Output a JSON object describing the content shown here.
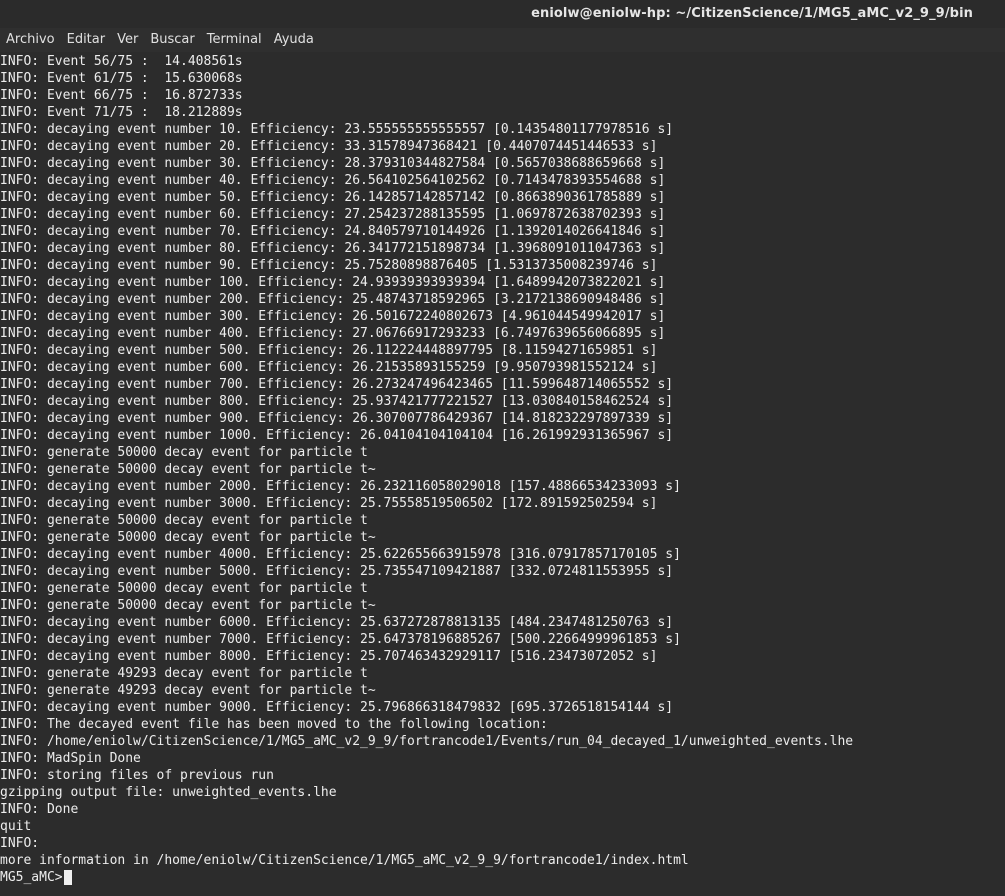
{
  "window": {
    "title": "eniolw@eniolw-hp: ~/CitizenScience/1/MG5_aMC_v2_9_9/bin"
  },
  "menu": {
    "items": [
      "Archivo",
      "Editar",
      "Ver",
      "Buscar",
      "Terminal",
      "Ayuda"
    ]
  },
  "terminal": {
    "lines": [
      "INFO: Event 56/75 :  14.408561s",
      "INFO: Event 61/75 :  15.630068s",
      "INFO: Event 66/75 :  16.872733s",
      "INFO: Event 71/75 :  18.212889s",
      "INFO: decaying event number 10. Efficiency: 23.555555555555557 [0.14354801177978516 s]",
      "INFO: decaying event number 20. Efficiency: 33.31578947368421 [0.4407074451446533 s]",
      "INFO: decaying event number 30. Efficiency: 28.379310344827584 [0.5657038688659668 s]",
      "INFO: decaying event number 40. Efficiency: 26.564102564102562 [0.7143478393554688 s]",
      "INFO: decaying event number 50. Efficiency: 26.142857142857142 [0.8663890361785889 s]",
      "INFO: decaying event number 60. Efficiency: 27.254237288135595 [1.0697872638702393 s]",
      "INFO: decaying event number 70. Efficiency: 24.840579710144926 [1.1392014026641846 s]",
      "INFO: decaying event number 80. Efficiency: 26.341772151898734 [1.3968091011047363 s]",
      "INFO: decaying event number 90. Efficiency: 25.75280898876405 [1.5313735008239746 s]",
      "INFO: decaying event number 100. Efficiency: 24.93939393939394 [1.6489942073822021 s]",
      "INFO: decaying event number 200. Efficiency: 25.48743718592965 [3.2172138690948486 s]",
      "INFO: decaying event number 300. Efficiency: 26.501672240802673 [4.961044549942017 s]",
      "INFO: decaying event number 400. Efficiency: 27.06766917293233 [6.7497639656066895 s]",
      "INFO: decaying event number 500. Efficiency: 26.112224448897795 [8.11594271659851 s]",
      "INFO: decaying event number 600. Efficiency: 26.21535893155259 [9.950793981552124 s]",
      "INFO: decaying event number 700. Efficiency: 26.273247496423465 [11.599648714065552 s]",
      "INFO: decaying event number 800. Efficiency: 25.937421777221527 [13.030840158462524 s]",
      "INFO: decaying event number 900. Efficiency: 26.307007786429367 [14.818232297897339 s]",
      "INFO: decaying event number 1000. Efficiency: 26.04104104104104 [16.261992931365967 s]",
      "INFO: generate 50000 decay event for particle t",
      "INFO: generate 50000 decay event for particle t~",
      "INFO: decaying event number 2000. Efficiency: 26.232116058029018 [157.48866534233093 s]",
      "INFO: decaying event number 3000. Efficiency: 25.75558519506502 [172.891592502594 s]",
      "INFO: generate 50000 decay event for particle t",
      "INFO: generate 50000 decay event for particle t~",
      "INFO: decaying event number 4000. Efficiency: 25.622655663915978 [316.07917857170105 s]",
      "INFO: decaying event number 5000. Efficiency: 25.735547109421887 [332.0724811553955 s]",
      "INFO: generate 50000 decay event for particle t",
      "INFO: generate 50000 decay event for particle t~",
      "INFO: decaying event number 6000. Efficiency: 25.637272878813135 [484.2347481250763 s]",
      "INFO: decaying event number 7000. Efficiency: 25.647378196885267 [500.22664999961853 s]",
      "INFO: decaying event number 8000. Efficiency: 25.707463432929117 [516.23473072052 s]",
      "INFO: generate 49293 decay event for particle t",
      "INFO: generate 49293 decay event for particle t~",
      "INFO: decaying event number 9000. Efficiency: 25.796866318479832 [695.3726518154144 s]",
      "INFO: The decayed event file has been moved to the following location:",
      "INFO: /home/eniolw/CitizenScience/1/MG5_aMC_v2_9_9/fortrancode1/Events/run_04_decayed_1/unweighted_events.lhe",
      "INFO: MadSpin Done",
      "INFO: storing files of previous run",
      "gzipping output file: unweighted_events.lhe",
      "INFO: Done",
      "quit",
      "INFO: ",
      "more information in /home/eniolw/CitizenScience/1/MG5_aMC_v2_9_9/fortrancode1/index.html"
    ],
    "prompt": "MG5_aMC>"
  },
  "colors": {
    "background": "#2c2c2c",
    "text": "#ededed",
    "cursor": "#f0f0f0"
  }
}
